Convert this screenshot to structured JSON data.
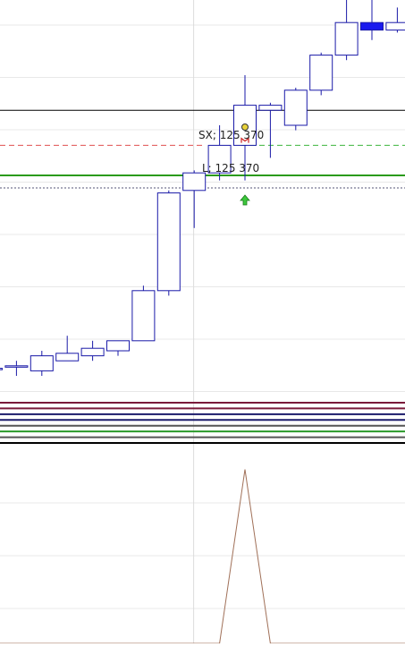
{
  "chart_data": {
    "type": "candlestick",
    "colors": {
      "background": "#ffffff",
      "grid": "#e8e8e8",
      "candle_border": "#1a1aa8",
      "candle_fill_hollow": "#ffffff",
      "candle_fill_solid": "#1a1aee",
      "black_level": "#000000",
      "green_level": "#2a9a1a",
      "red_dashed": "#e05050",
      "green_dashed": "#3cb43c",
      "gray_dotted": "#555577",
      "indicator_line": "#a07058",
      "buy_arrow": "#3cc83c",
      "marker_red": "#cc2222",
      "marker_yellow": "#e8d23a"
    },
    "price_panel": {
      "grid": true,
      "ylim": [
        125280,
        125440
      ],
      "candles": [
        {
          "open": 125293,
          "close": 125293,
          "high": 125296,
          "low": 125290,
          "filled": false
        },
        {
          "open": 125294,
          "close": 125294,
          "high": 125296,
          "low": 125290,
          "filled": false
        },
        {
          "open": 125292,
          "close": 125298,
          "high": 125300,
          "low": 125290,
          "filled": false
        },
        {
          "open": 125296,
          "close": 125299,
          "high": 125306,
          "low": 125296,
          "filled": false
        },
        {
          "open": 125298,
          "close": 125301,
          "high": 125304,
          "low": 125296,
          "filled": false
        },
        {
          "open": 125300,
          "close": 125304,
          "high": 125304,
          "low": 125298,
          "filled": false
        },
        {
          "open": 125304,
          "close": 125324,
          "high": 125326,
          "low": 125304,
          "filled": false
        },
        {
          "open": 125324,
          "close": 125363,
          "high": 125364,
          "low": 125322,
          "filled": false
        },
        {
          "open": 125364,
          "close": 125371,
          "high": 125372,
          "low": 125349,
          "filled": false
        },
        {
          "open": 125371,
          "close": 125382,
          "high": 125390,
          "low": 125368,
          "filled": false
        },
        {
          "open": 125382,
          "close": 125398,
          "high": 125410,
          "low": 125368,
          "filled": false
        },
        {
          "open": 125396,
          "close": 125398,
          "high": 125399,
          "low": 125377,
          "filled": false
        },
        {
          "open": 125390,
          "close": 125404,
          "high": 125405,
          "low": 125388,
          "filled": false
        },
        {
          "open": 125404,
          "close": 125418,
          "high": 125419,
          "low": 125402,
          "filled": false
        },
        {
          "open": 125418,
          "close": 125431,
          "high": 125440,
          "low": 125416,
          "filled": false
        },
        {
          "open": 125431,
          "close": 125428,
          "high": 125440,
          "low": 125424,
          "filled": true
        },
        {
          "open": 125428,
          "close": 125431,
          "high": 125437,
          "low": 125427,
          "filled": false
        },
        {
          "open": 125430,
          "close": 125432,
          "high": 125434,
          "low": 125427,
          "filled": false
        }
      ],
      "horizontal_levels": [
        {
          "price": 125396,
          "style": "solid",
          "color_key": "black_level"
        },
        {
          "price": 125370,
          "style": "solid",
          "color_key": "green_level"
        },
        {
          "price": 125382,
          "style": "dashed",
          "color_key": "red_dashed"
        },
        {
          "price": 125382,
          "style": "dashed",
          "color_key": "green_dashed"
        },
        {
          "price": 125365,
          "style": "dotted",
          "color_key": "gray_dotted"
        }
      ],
      "cursor_bar_index": 9,
      "annotations": [
        {
          "text": "SX; 125 370",
          "kind": "short_exit"
        },
        {
          "text": "L; 125 370",
          "kind": "long_entry"
        }
      ]
    },
    "indicator_panel": {
      "grid": true,
      "ylim": [
        0,
        10
      ],
      "bands": [
        {
          "color": "#7a1a3a"
        },
        {
          "color": "#7a1a3a"
        },
        {
          "color": "#1a1a6a"
        },
        {
          "color": "#1a1a6a"
        },
        {
          "color": "#555555"
        },
        {
          "color": "#2a9a2a"
        },
        {
          "color": "#555555"
        },
        {
          "color": "#000000"
        }
      ],
      "line_values": [
        0,
        0,
        0,
        0,
        0,
        0,
        0,
        0,
        0,
        0,
        9,
        0,
        0,
        0,
        0,
        0,
        0,
        0
      ]
    }
  }
}
